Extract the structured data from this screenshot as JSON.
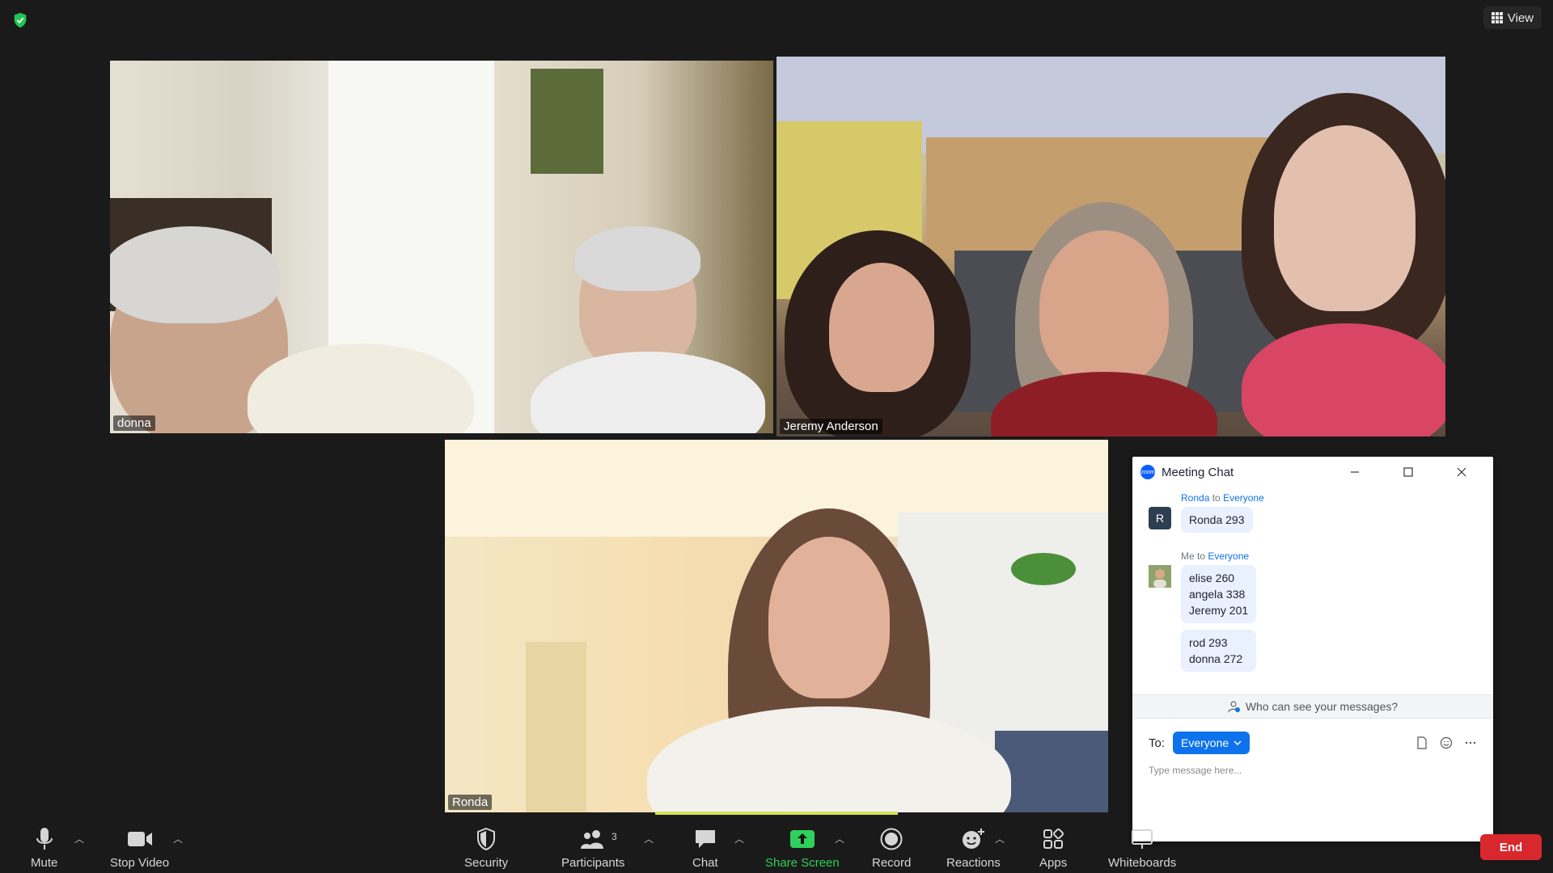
{
  "top": {
    "security_icon": "shield-check-icon",
    "view_label": "View"
  },
  "participants": [
    {
      "name": "donna"
    },
    {
      "name": "Jeremy Anderson"
    },
    {
      "name": "Ronda"
    }
  ],
  "chat": {
    "title": "Meeting Chat",
    "messages": [
      {
        "sender": "Ronda",
        "to_word": "to",
        "recipient": "Everyone",
        "avatar_letter": "R",
        "bubbles": [
          "Ronda 293"
        ]
      },
      {
        "sender": "Me",
        "to_word": "to",
        "recipient": "Everyone",
        "bubbles": [
          "elise 260\nangela 338\nJeremy 201",
          "rod 293\ndonna 272"
        ]
      }
    ],
    "who_can_see": "Who can see your messages?",
    "to_label": "To:",
    "to_value": "Everyone",
    "input_placeholder": "Type message here..."
  },
  "toolbar": {
    "mute": "Mute",
    "stop_video": "Stop Video",
    "security": "Security",
    "participants": "Participants",
    "participants_count": "3",
    "chat": "Chat",
    "share_screen": "Share Screen",
    "record": "Record",
    "reactions": "Reactions",
    "apps": "Apps",
    "whiteboards": "Whiteboards",
    "end": "End"
  },
  "colors": {
    "active_speaker": "#d4e157",
    "share_green": "#2fd05c",
    "end_red": "#d9272e",
    "chat_blue": "#0e72ed"
  }
}
